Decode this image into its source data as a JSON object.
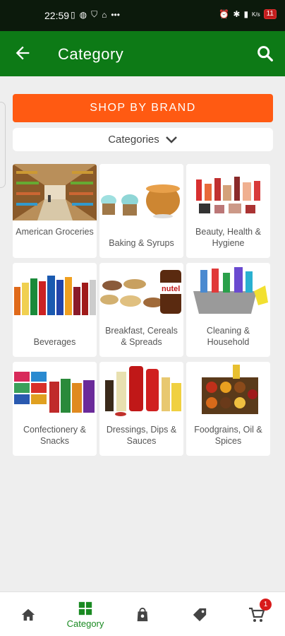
{
  "status_bar": {
    "time": "22:59",
    "speed_unit": "K/s",
    "battery": "11"
  },
  "app_bar": {
    "title": "Category"
  },
  "shop_by_brand": {
    "label": "SHOP BY BRAND"
  },
  "categories_dropdown": {
    "label": "Categories"
  },
  "categories": [
    {
      "label": "American Groceries",
      "icon": "grocery-aisle-image"
    },
    {
      "label": "Baking & Syrups",
      "icon": "cupcakes-syrup-image"
    },
    {
      "label": "Beauty, Health & Hygiene",
      "icon": "cosmetics-image"
    },
    {
      "label": "Beverages",
      "icon": "drink-bottles-image"
    },
    {
      "label": "Breakfast, Cereals & Spreads",
      "icon": "cereal-bowls-image"
    },
    {
      "label": "Cleaning & Household",
      "icon": "cleaning-supplies-image"
    },
    {
      "label": "Confectionery & Snacks",
      "icon": "snack-packs-image"
    },
    {
      "label": "Dressings, Dips & Sauces",
      "icon": "sauce-bottles-image"
    },
    {
      "label": "Foodgrains, Oil & Spices",
      "icon": "spice-bowls-image"
    }
  ],
  "bottom_nav": {
    "items": [
      {
        "label": "",
        "icon": "home-icon"
      },
      {
        "label": "Category",
        "icon": "category-grid-icon"
      },
      {
        "label": "",
        "icon": "shopping-bag-icon"
      },
      {
        "label": "",
        "icon": "tag-icon"
      },
      {
        "label": "",
        "icon": "cart-icon"
      }
    ],
    "cart_badge": "1"
  },
  "colors": {
    "app_bar": "#0d7a16",
    "status_bar": "#0c1a0c",
    "brand_button": "#ff5a12",
    "active_nav": "#1a8a22",
    "badge": "#d81b1b"
  }
}
